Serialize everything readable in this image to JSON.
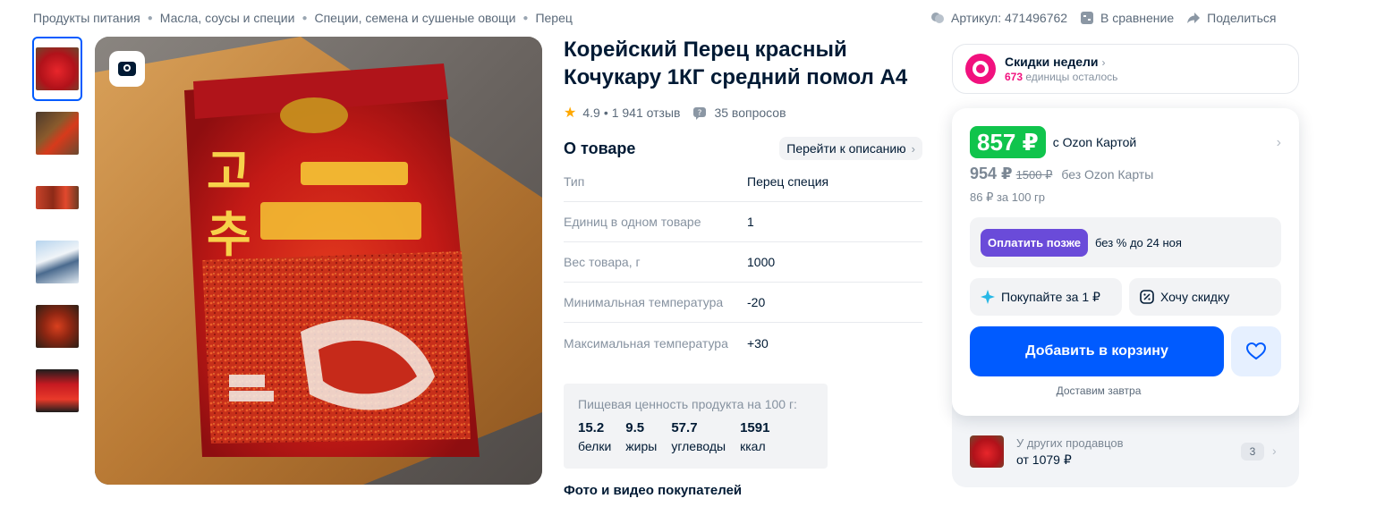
{
  "breadcrumb": [
    {
      "label": "Продукты питания"
    },
    {
      "label": "Масла, соусы и специи"
    },
    {
      "label": "Специи, семена и сушеные овощи"
    },
    {
      "label": "Перец"
    }
  ],
  "meta": {
    "article": "Артикул: 471496762",
    "compare": "В сравнение",
    "share": "Поделиться"
  },
  "gallery": {
    "thumb_count": 6,
    "active_index": 0,
    "main_image_icon": "image-search-icon"
  },
  "product": {
    "title": "Корейский Перец красный Кочукару 1КГ средний помол А4",
    "rating": "4.9",
    "reviews": "1 941 отзыв",
    "questions": "35 вопросов"
  },
  "about": {
    "heading": "О товаре",
    "to_description": "Перейти к описанию",
    "specs": [
      {
        "key": "Тип",
        "value": "Перец специя"
      },
      {
        "key": "Единиц в одном товаре",
        "value": "1"
      },
      {
        "key": "Вес товара, г",
        "value": "1000"
      },
      {
        "key": "Минимальная температура",
        "value": "-20"
      },
      {
        "key": "Максимальная температура",
        "value": "+30"
      }
    ]
  },
  "nutrition": {
    "caption": "Пищевая ценность продукта на 100 г:",
    "items": [
      {
        "value": "15.2",
        "label": "белки"
      },
      {
        "value": "9.5",
        "label": "жиры"
      },
      {
        "value": "57.7",
        "label": "углеводы"
      },
      {
        "value": "1591",
        "label": "ккал"
      }
    ]
  },
  "photos_heading": "Фото и видео покупателей",
  "week_deals": {
    "title": "Скидки недели",
    "remaining_count": "673",
    "remaining_text": " единицы осталось"
  },
  "pricing": {
    "card_price": "857 ₽",
    "card_label": "с Ozon Картой",
    "price": "954 ₽",
    "old_price": "1500 ₽",
    "without_card": "без Ozon Карты",
    "per_100": "86 ₽ за 100 гр"
  },
  "pay_later": {
    "button": "Оплатить позже",
    "text": "без % до 24 ноя"
  },
  "actions": {
    "buy_for_1": "Покупайте за 1 ₽",
    "want_discount": "Хочу скидку",
    "add_to_cart": "Добавить в корзину",
    "delivery": "Доставим завтра"
  },
  "other_sellers": {
    "title": "У других продавцов",
    "price": "от 1079 ₽",
    "count": "3"
  },
  "colors": {
    "accent": "#005bff",
    "price_green": "#10c44c",
    "deal_pink": "#f1117e",
    "pay_later_purple": "#6a4bd9",
    "star": "#ffa800"
  }
}
